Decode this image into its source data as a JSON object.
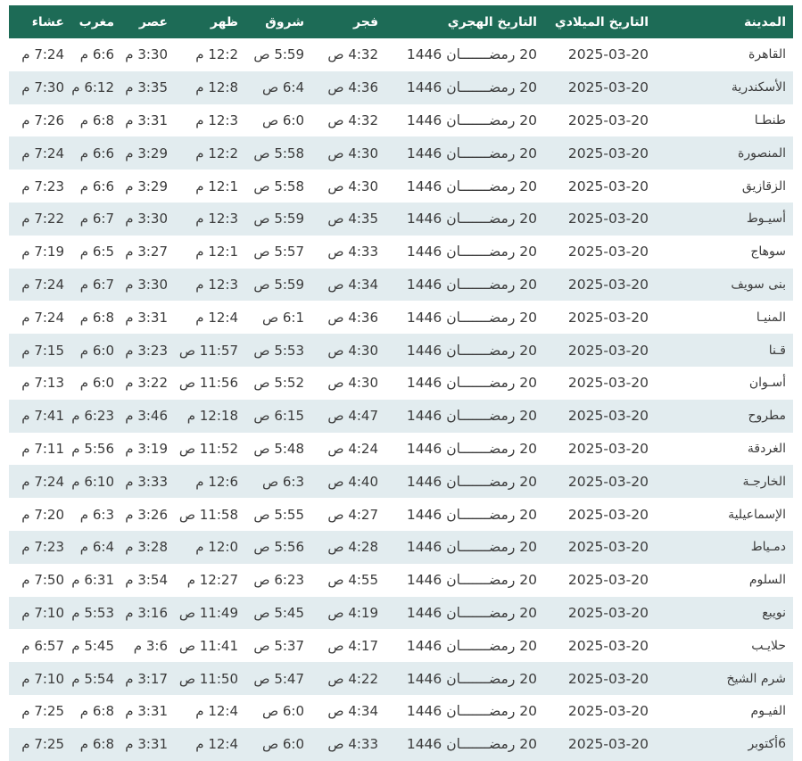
{
  "table": {
    "columns": [
      "المدينة",
      "التاريخ الميلادي",
      "التاريخ الهجري",
      "فجر",
      "شروق",
      "ظهر",
      "عصر",
      "مغرب",
      "عشاء"
    ],
    "rows": [
      [
        "القاهرة",
        "2025-03-20",
        "20 رمضـــــــان 1446",
        "4:32 ص",
        "5:59 ص",
        "12:2 م",
        "3:30 م",
        "6:6 م",
        "7:24 م"
      ],
      [
        "الأسكندرية",
        "2025-03-20",
        "20 رمضـــــــان 1446",
        "4:36 ص",
        "6:4 ص",
        "12:8 م",
        "3:35 م",
        "6:12 م",
        "7:30 م"
      ],
      [
        "طنطـا",
        "2025-03-20",
        "20 رمضـــــــان 1446",
        "4:32 ص",
        "6:0 ص",
        "12:3 م",
        "3:31 م",
        "6:8 م",
        "7:26 م"
      ],
      [
        "المنصورة",
        "2025-03-20",
        "20 رمضـــــــان 1446",
        "4:30 ص",
        "5:58 ص",
        "12:2 م",
        "3:29 م",
        "6:6 م",
        "7:24 م"
      ],
      [
        "الزقازيق",
        "2025-03-20",
        "20 رمضـــــــان 1446",
        "4:30 ص",
        "5:58 ص",
        "12:1 م",
        "3:29 م",
        "6:6 م",
        "7:23 م"
      ],
      [
        "أسيـوط",
        "2025-03-20",
        "20 رمضـــــــان 1446",
        "4:35 ص",
        "5:59 ص",
        "12:3 م",
        "3:30 م",
        "6:7 م",
        "7:22 م"
      ],
      [
        "سوهاج",
        "2025-03-20",
        "20 رمضـــــــان 1446",
        "4:33 ص",
        "5:57 ص",
        "12:1 م",
        "3:27 م",
        "6:5 م",
        "7:19 م"
      ],
      [
        "بنى سويف",
        "2025-03-20",
        "20 رمضـــــــان 1446",
        "4:34 ص",
        "5:59 ص",
        "12:3 م",
        "3:30 م",
        "6:7 م",
        "7:24 م"
      ],
      [
        "المنيـا",
        "2025-03-20",
        "20 رمضـــــــان 1446",
        "4:36 ص",
        "6:1 ص",
        "12:4 م",
        "3:31 م",
        "6:8 م",
        "7:24 م"
      ],
      [
        "قـنا",
        "2025-03-20",
        "20 رمضـــــــان 1446",
        "4:30 ص",
        "5:53 ص",
        "11:57 ص",
        "3:23 م",
        "6:0 م",
        "7:15 م"
      ],
      [
        "أسـوان",
        "2025-03-20",
        "20 رمضـــــــان 1446",
        "4:30 ص",
        "5:52 ص",
        "11:56 ص",
        "3:22 م",
        "6:0 م",
        "7:13 م"
      ],
      [
        "مطروح",
        "2025-03-20",
        "20 رمضـــــــان 1446",
        "4:47 ص",
        "6:15 ص",
        "12:18 م",
        "3:46 م",
        "6:23 م",
        "7:41 م"
      ],
      [
        "الغردقة",
        "2025-03-20",
        "20 رمضـــــــان 1446",
        "4:24 ص",
        "5:48 ص",
        "11:52 ص",
        "3:19 م",
        "5:56 م",
        "7:11 م"
      ],
      [
        "الخارجـة",
        "2025-03-20",
        "20 رمضـــــــان 1446",
        "4:40 ص",
        "6:3 ص",
        "12:6 م",
        "3:33 م",
        "6:10 م",
        "7:24 م"
      ],
      [
        "الإسماعيلية",
        "2025-03-20",
        "20 رمضـــــــان 1446",
        "4:27 ص",
        "5:55 ص",
        "11:58 ص",
        "3:26 م",
        "6:3 م",
        "7:20 م"
      ],
      [
        "دمـياط",
        "2025-03-20",
        "20 رمضـــــــان 1446",
        "4:28 ص",
        "5:56 ص",
        "12:0 م",
        "3:28 م",
        "6:4 م",
        "7:23 م"
      ],
      [
        "السلوم",
        "2025-03-20",
        "20 رمضـــــــان 1446",
        "4:55 ص",
        "6:23 ص",
        "12:27 م",
        "3:54 م",
        "6:31 م",
        "7:50 م"
      ],
      [
        "نويبع",
        "2025-03-20",
        "20 رمضـــــــان 1446",
        "4:19 ص",
        "5:45 ص",
        "11:49 ص",
        "3:16 م",
        "5:53 م",
        "7:10 م"
      ],
      [
        "حلايـب",
        "2025-03-20",
        "20 رمضـــــــان 1446",
        "4:17 ص",
        "5:37 ص",
        "11:41 ص",
        "3:6 م",
        "5:45 م",
        "6:57 م"
      ],
      [
        "شرم الشيخ",
        "2025-03-20",
        "20 رمضـــــــان 1446",
        "4:22 ص",
        "5:47 ص",
        "11:50 ص",
        "3:17 م",
        "5:54 م",
        "7:10 م"
      ],
      [
        "الفيـوم",
        "2025-03-20",
        "20 رمضـــــــان 1446",
        "4:34 ص",
        "6:0 ص",
        "12:4 م",
        "3:31 م",
        "6:8 م",
        "7:25 م"
      ],
      [
        "6أكتوبر",
        "2025-03-20",
        "20 رمضـــــــان 1446",
        "4:33 ص",
        "6:0 ص",
        "12:4 م",
        "3:31 م",
        "6:8 م",
        "7:25 م"
      ]
    ]
  },
  "colors": {
    "header_bg": "#1d6b56",
    "header_text": "#ffffff",
    "row_alt_bg": "#e2ecef",
    "row_bg": "#ffffff",
    "cell_text": "#3b3b3b"
  }
}
